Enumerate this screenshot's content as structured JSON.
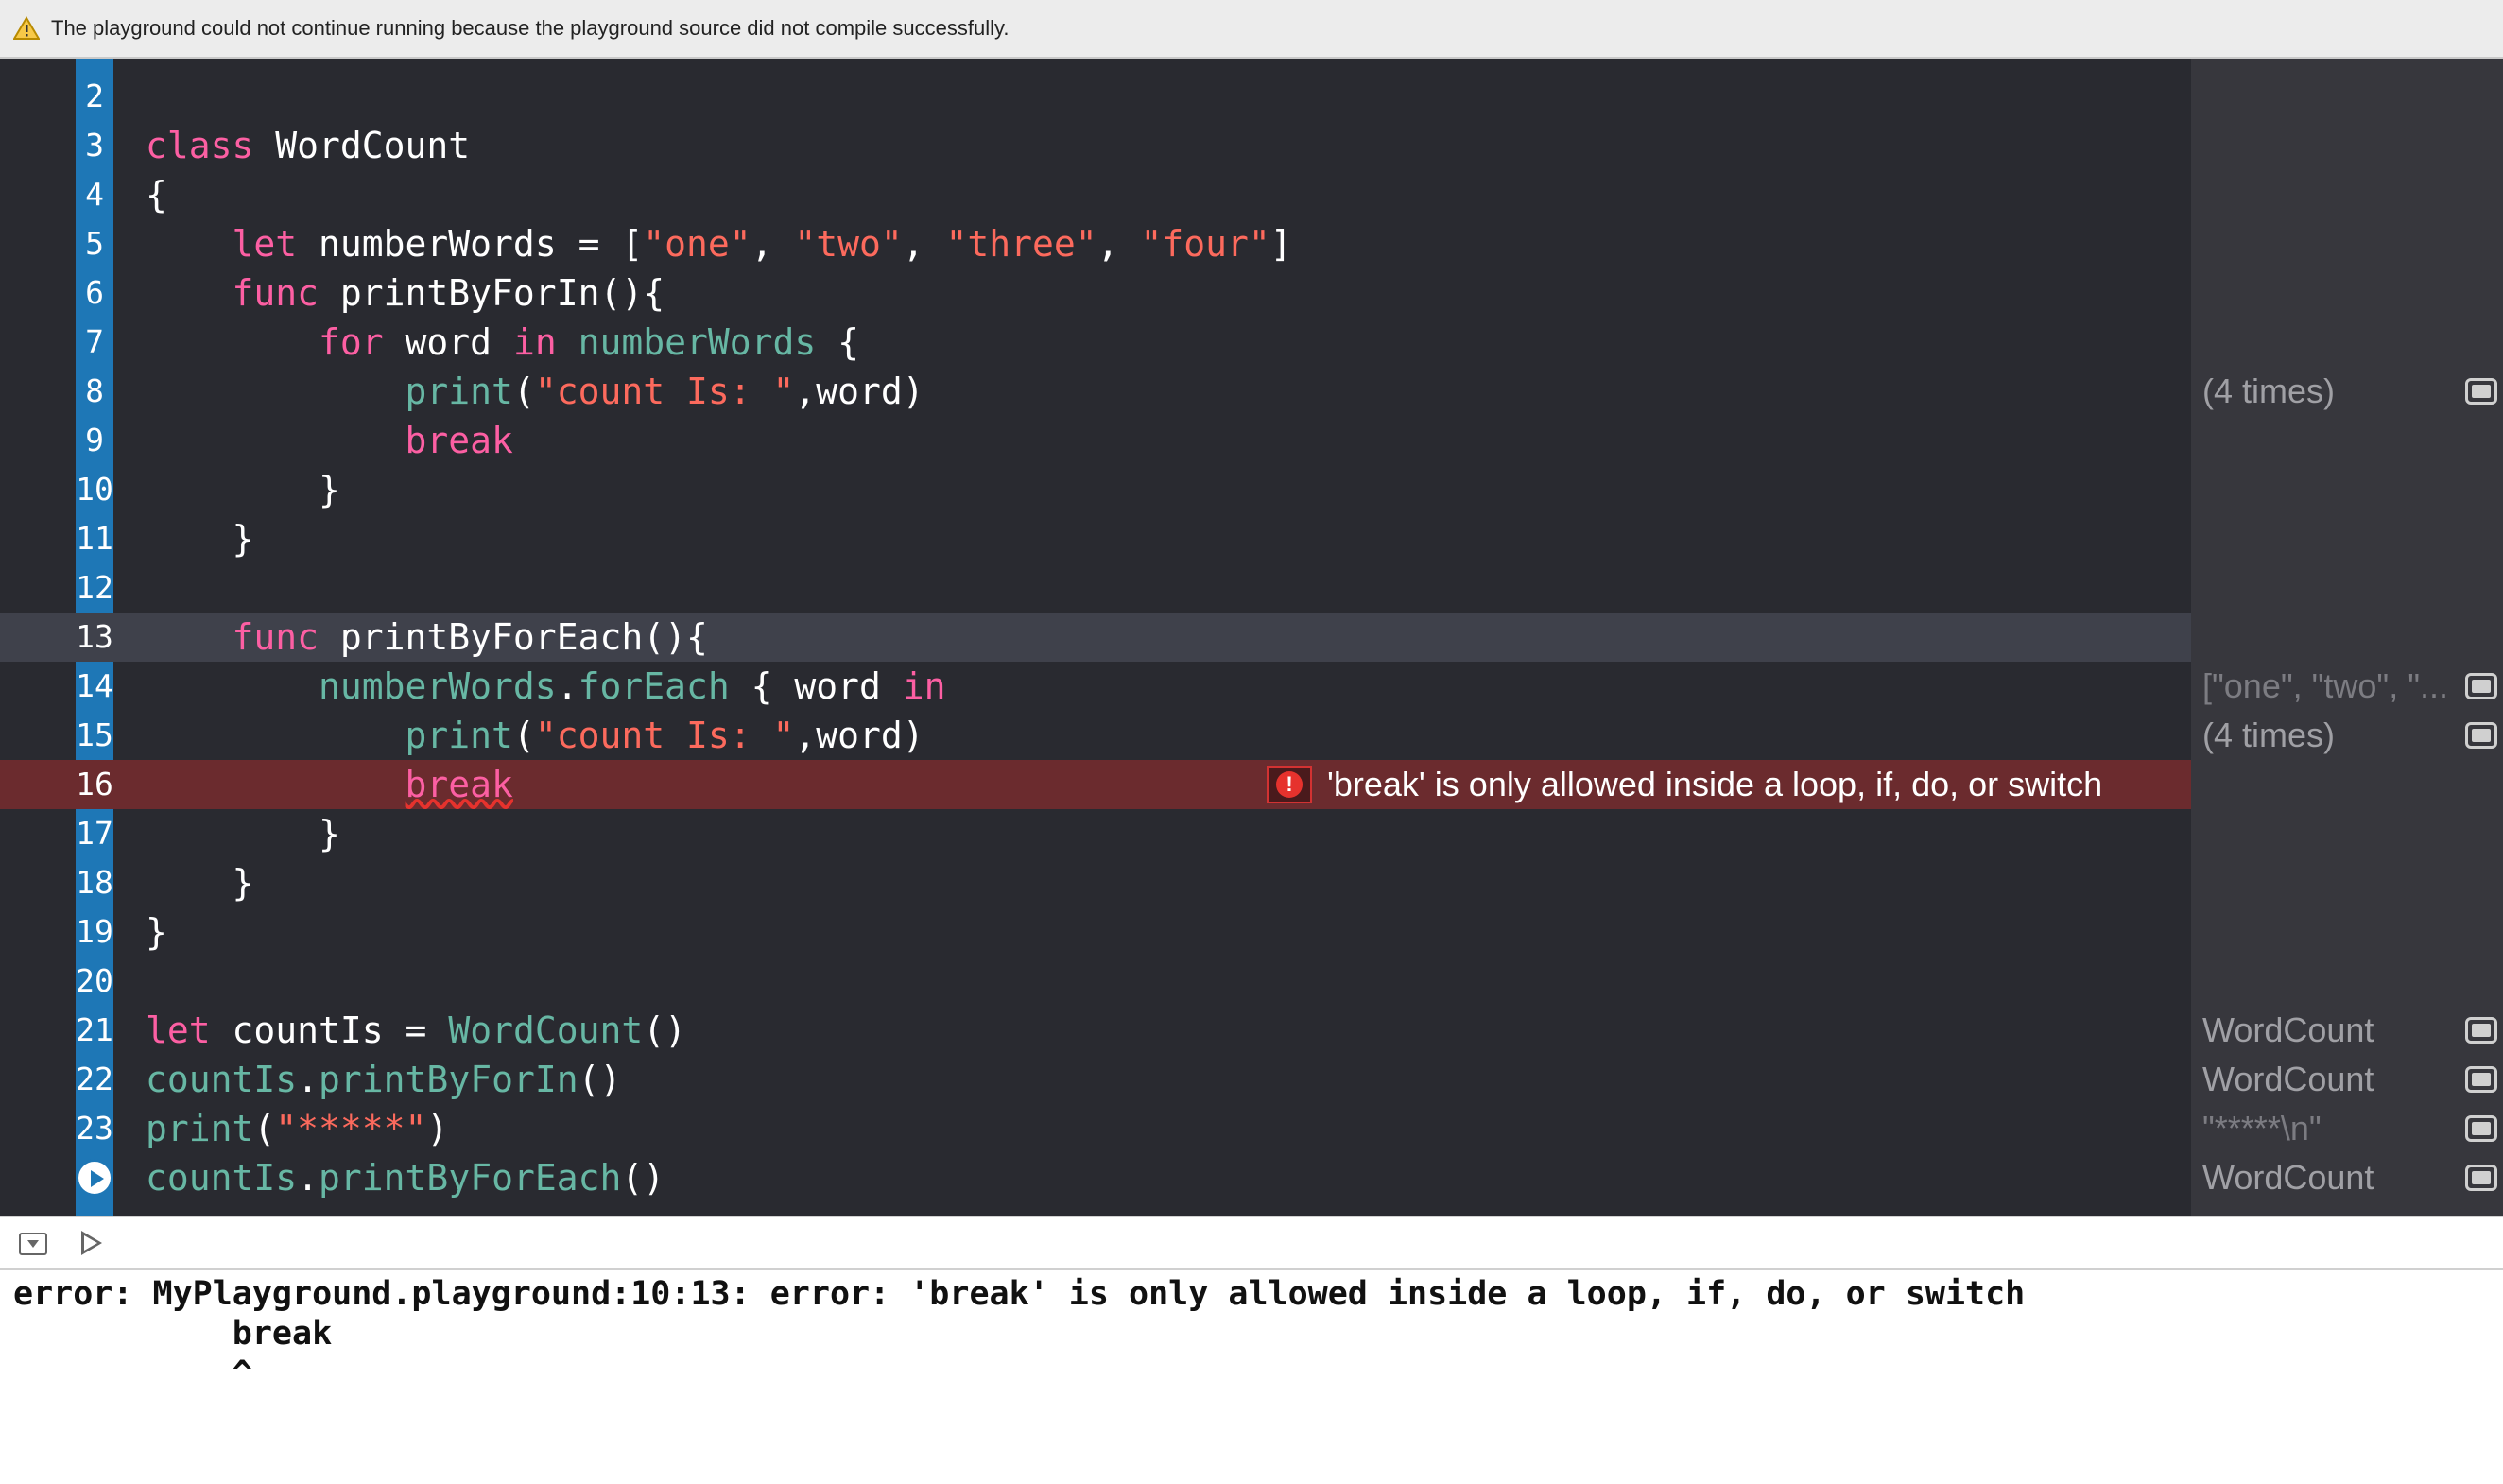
{
  "banner": {
    "icon": "warning-triangle-icon",
    "message": "The playground could not continue running because the playground source did not compile successfully."
  },
  "editor": {
    "lines": [
      {
        "num": "2",
        "tokens": []
      },
      {
        "num": "3",
        "tokens": [
          {
            "t": "class",
            "c": "kw"
          },
          {
            "t": " WordCount",
            "c": "plain"
          }
        ]
      },
      {
        "num": "4",
        "tokens": [
          {
            "t": "{",
            "c": "plain"
          }
        ]
      },
      {
        "num": "5",
        "tokens": [
          {
            "t": "    ",
            "c": "plain"
          },
          {
            "t": "let",
            "c": "kw"
          },
          {
            "t": " numberWords = [",
            "c": "plain"
          },
          {
            "t": "\"one\"",
            "c": "str"
          },
          {
            "t": ", ",
            "c": "plain"
          },
          {
            "t": "\"two\"",
            "c": "str"
          },
          {
            "t": ", ",
            "c": "plain"
          },
          {
            "t": "\"three\"",
            "c": "str"
          },
          {
            "t": ", ",
            "c": "plain"
          },
          {
            "t": "\"four\"",
            "c": "str"
          },
          {
            "t": "]",
            "c": "plain"
          }
        ]
      },
      {
        "num": "6",
        "tokens": [
          {
            "t": "    ",
            "c": "plain"
          },
          {
            "t": "func",
            "c": "kw"
          },
          {
            "t": " printByForIn(){",
            "c": "plain"
          }
        ]
      },
      {
        "num": "7",
        "tokens": [
          {
            "t": "        ",
            "c": "plain"
          },
          {
            "t": "for",
            "c": "kw"
          },
          {
            "t": " word ",
            "c": "plain"
          },
          {
            "t": "in",
            "c": "kw"
          },
          {
            "t": " ",
            "c": "plain"
          },
          {
            "t": "numberWords",
            "c": "fn"
          },
          {
            "t": " {",
            "c": "plain"
          }
        ]
      },
      {
        "num": "8",
        "tokens": [
          {
            "t": "            ",
            "c": "plain"
          },
          {
            "t": "print",
            "c": "fn"
          },
          {
            "t": "(",
            "c": "plain"
          },
          {
            "t": "\"count Is: \"",
            "c": "str"
          },
          {
            "t": ",word)",
            "c": "plain"
          }
        ]
      },
      {
        "num": "9",
        "tokens": [
          {
            "t": "            ",
            "c": "plain"
          },
          {
            "t": "break",
            "c": "kw"
          }
        ]
      },
      {
        "num": "10",
        "tokens": [
          {
            "t": "        }",
            "c": "plain"
          }
        ]
      },
      {
        "num": "11",
        "tokens": [
          {
            "t": "    }",
            "c": "plain"
          }
        ]
      },
      {
        "num": "12",
        "tokens": []
      },
      {
        "num": "13",
        "current": true,
        "tokens": [
          {
            "t": "    ",
            "c": "plain"
          },
          {
            "t": "func",
            "c": "kw"
          },
          {
            "t": " printByForEach(){",
            "c": "plain"
          }
        ]
      },
      {
        "num": "14",
        "tokens": [
          {
            "t": "        ",
            "c": "plain"
          },
          {
            "t": "numberWords",
            "c": "fn"
          },
          {
            "t": ".",
            "c": "plain"
          },
          {
            "t": "forEach",
            "c": "fn"
          },
          {
            "t": " { word ",
            "c": "plain"
          },
          {
            "t": "in",
            "c": "kw"
          }
        ]
      },
      {
        "num": "15",
        "tokens": [
          {
            "t": "            ",
            "c": "plain"
          },
          {
            "t": "print",
            "c": "fn"
          },
          {
            "t": "(",
            "c": "plain"
          },
          {
            "t": "\"count Is: \"",
            "c": "str"
          },
          {
            "t": ",word)",
            "c": "plain"
          }
        ]
      },
      {
        "num": "16",
        "error": true,
        "tokens": [
          {
            "t": "            ",
            "c": "plain"
          },
          {
            "t": "break",
            "c": "kw"
          }
        ]
      },
      {
        "num": "17",
        "tokens": [
          {
            "t": "        }",
            "c": "plain"
          }
        ]
      },
      {
        "num": "18",
        "tokens": [
          {
            "t": "    }",
            "c": "plain"
          }
        ]
      },
      {
        "num": "19",
        "tokens": [
          {
            "t": "}",
            "c": "plain"
          }
        ]
      },
      {
        "num": "20",
        "tokens": []
      },
      {
        "num": "21",
        "tokens": [
          {
            "t": "let",
            "c": "kw"
          },
          {
            "t": " countIs = ",
            "c": "plain"
          },
          {
            "t": "WordCount",
            "c": "fn"
          },
          {
            "t": "()",
            "c": "plain"
          }
        ]
      },
      {
        "num": "22",
        "tokens": [
          {
            "t": "countIs",
            "c": "fn"
          },
          {
            "t": ".",
            "c": "plain"
          },
          {
            "t": "printByForIn",
            "c": "fn"
          },
          {
            "t": "()",
            "c": "plain"
          }
        ]
      },
      {
        "num": "23",
        "tokens": [
          {
            "t": "print",
            "c": "fn"
          },
          {
            "t": "(",
            "c": "plain"
          },
          {
            "t": "\"*****\"",
            "c": "str"
          },
          {
            "t": ")",
            "c": "plain"
          }
        ]
      },
      {
        "num": "",
        "run": true,
        "tokens": [
          {
            "t": "countIs",
            "c": "fn"
          },
          {
            "t": ".",
            "c": "plain"
          },
          {
            "t": "printByForEach",
            "c": "fn"
          },
          {
            "t": "()",
            "c": "plain"
          }
        ]
      }
    ],
    "error_message": "'break' is only allowed inside a loop, if, do, or switch",
    "error_icon": "exclamation-circle-icon",
    "run_icon": "run-play-icon"
  },
  "results": [
    {
      "line": "8",
      "text": "(4 times)",
      "dim": false
    },
    {
      "line": "14",
      "text": "[\"one\", \"two\", \"...",
      "dim": true
    },
    {
      "line": "15",
      "text": "(4 times)",
      "dim": false
    },
    {
      "line": "21",
      "text": "WordCount",
      "dim": false
    },
    {
      "line": "22",
      "text": "WordCount",
      "dim": false
    },
    {
      "line": "23",
      "text": "\"*****\\n\"",
      "dim": true
    },
    {
      "line": "24",
      "text": "WordCount",
      "dim": false
    }
  ],
  "debug_bar": {
    "hide_icon": "hide-debug-area-icon",
    "play_icon": "play-outline-icon"
  },
  "console": {
    "lines": [
      "error: MyPlayground.playground:10:13: error: 'break' is only allowed inside a loop, if, do, or switch",
      "           break",
      "           ^"
    ]
  }
}
